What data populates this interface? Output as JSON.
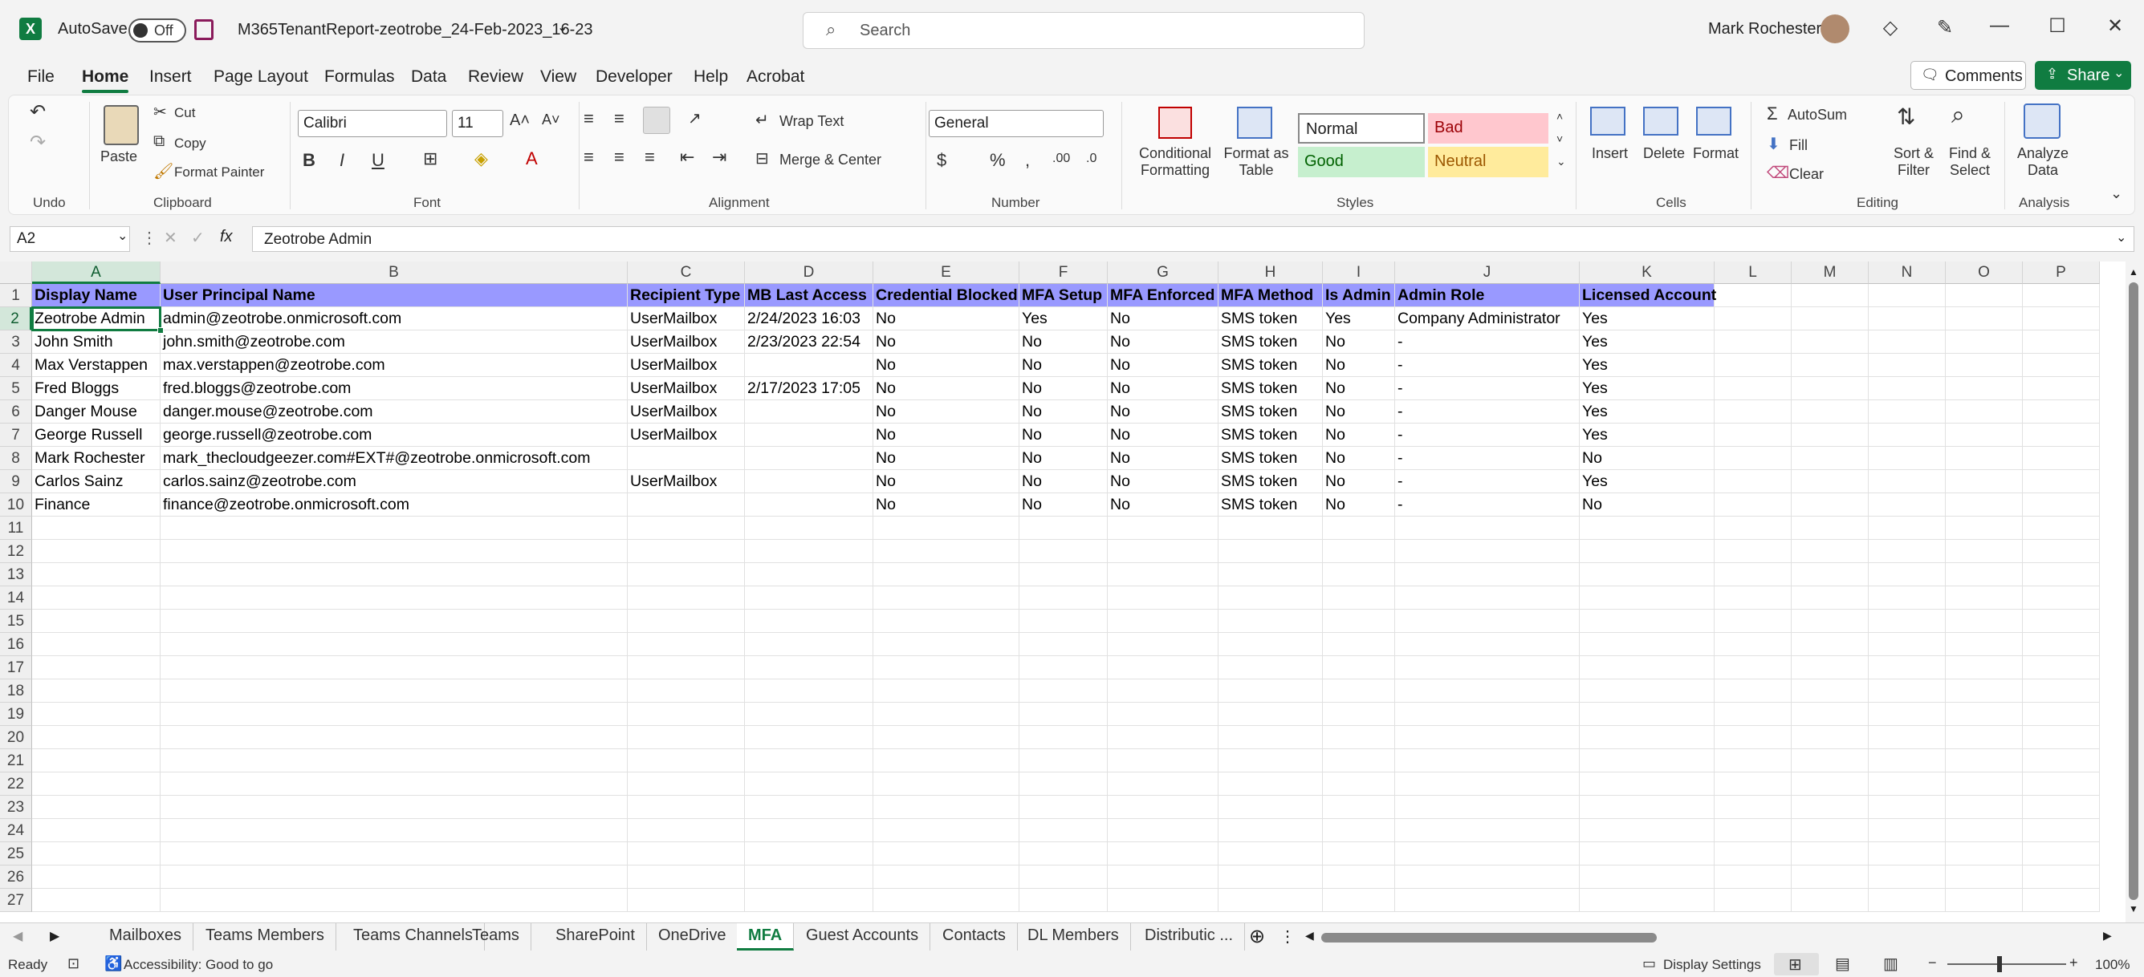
{
  "window": {
    "autosave_label": "AutoSave",
    "autosave_state": "Off",
    "file_name": "M365TenantReport-zeotrobe_24-Feb-2023_16-23",
    "search_placeholder": "Search",
    "user_name": "Mark Rochester"
  },
  "menu_tabs": [
    "File",
    "Home",
    "Insert",
    "Page Layout",
    "Formulas",
    "Data",
    "Review",
    "View",
    "Developer",
    "Help",
    "Acrobat"
  ],
  "menu_right": {
    "comments": "Comments",
    "share": "Share"
  },
  "ribbon": {
    "groups": [
      "Undo",
      "Clipboard",
      "Font",
      "Alignment",
      "Number",
      "Styles",
      "Cells",
      "Editing",
      "Analysis"
    ],
    "clipboard": {
      "paste": "Paste",
      "cut": "Cut",
      "copy": "Copy",
      "format_painter": "Format Painter"
    },
    "font": {
      "name": "Calibri",
      "size": "11"
    },
    "alignment": {
      "wrap_text": "Wrap Text",
      "merge_center": "Merge & Center"
    },
    "number": {
      "format": "General"
    },
    "styles": {
      "conditional_formatting": "Conditional Formatting",
      "format_as_table": "Format as Table",
      "normal": "Normal",
      "bad": "Bad",
      "good": "Good",
      "neutral": "Neutral"
    },
    "cells": {
      "insert": "Insert",
      "delete": "Delete",
      "format": "Format"
    },
    "editing": {
      "autosum": "AutoSum",
      "fill": "Fill",
      "clear": "Clear",
      "sort_filter": "Sort & Filter",
      "find_select": "Find & Select"
    },
    "analysis": {
      "analyze_data": "Analyze Data"
    }
  },
  "formula_bar": {
    "name_box": "A2",
    "fx": "fx",
    "content": "Zeotrobe Admin"
  },
  "grid": {
    "columns": [
      "A",
      "B",
      "C",
      "D",
      "E",
      "F",
      "G",
      "H",
      "I",
      "J",
      "K",
      "L",
      "M",
      "N",
      "O",
      "P"
    ],
    "header_row": [
      "Display Name",
      "User Principal Name",
      "Recipient Type",
      "MB Last Access",
      "Credential Blocked",
      "MFA Setup",
      "MFA Enforced",
      "MFA Method",
      "Is Admin",
      "Admin Role",
      "Licensed Account"
    ],
    "rows": [
      [
        "Zeotrobe Admin",
        "admin@zeotrobe.onmicrosoft.com",
        "UserMailbox",
        "2/24/2023 16:03",
        "No",
        "Yes",
        "No",
        "SMS token",
        "Yes",
        "Company Administrator",
        "Yes"
      ],
      [
        "John Smith",
        "john.smith@zeotrobe.com",
        "UserMailbox",
        "2/23/2023 22:54",
        "No",
        "No",
        "No",
        "SMS token",
        "No",
        "-",
        "Yes"
      ],
      [
        "Max Verstappen",
        "max.verstappen@zeotrobe.com",
        "UserMailbox",
        "",
        "No",
        "No",
        "No",
        "SMS token",
        "No",
        "-",
        "Yes"
      ],
      [
        "Fred Bloggs",
        "fred.bloggs@zeotrobe.com",
        "UserMailbox",
        "2/17/2023 17:05",
        "No",
        "No",
        "No",
        "SMS token",
        "No",
        "-",
        "Yes"
      ],
      [
        "Danger Mouse",
        "danger.mouse@zeotrobe.com",
        "UserMailbox",
        "",
        "No",
        "No",
        "No",
        "SMS token",
        "No",
        "-",
        "Yes"
      ],
      [
        "George Russell",
        "george.russell@zeotrobe.com",
        "UserMailbox",
        "",
        "No",
        "No",
        "No",
        "SMS token",
        "No",
        "-",
        "Yes"
      ],
      [
        "Mark Rochester",
        "mark_thecloudgeezer.com#EXT#@zeotrobe.onmicrosoft.com",
        "",
        "",
        "No",
        "No",
        "No",
        "SMS token",
        "No",
        "-",
        "No"
      ],
      [
        "Carlos Sainz",
        "carlos.sainz@zeotrobe.com",
        "UserMailbox",
        "",
        "No",
        "No",
        "No",
        "SMS token",
        "No",
        "-",
        "Yes"
      ],
      [
        "Finance",
        "finance@zeotrobe.onmicrosoft.com",
        "",
        "",
        "No",
        "No",
        "No",
        "SMS token",
        "No",
        "-",
        "No"
      ]
    ],
    "row_count": 27
  },
  "sheet_tabs": [
    "Mailboxes",
    "Teams Members",
    "Teams Channels",
    "Teams",
    "SharePoint",
    "OneDrive",
    "MFA",
    "Guest Accounts",
    "Contacts",
    "DL Members",
    "Distributic ..."
  ],
  "active_sheet": "MFA",
  "status": {
    "ready": "Ready",
    "accessibility": "Accessibility: Good to go",
    "display_settings": "Display Settings",
    "zoom": "100%"
  }
}
